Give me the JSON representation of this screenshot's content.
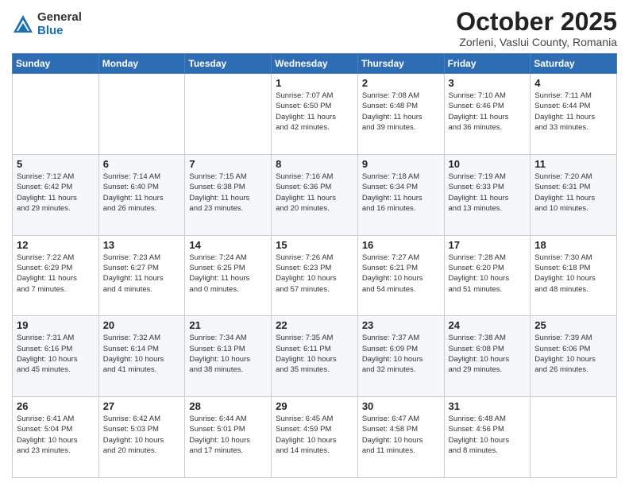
{
  "logo": {
    "general": "General",
    "blue": "Blue"
  },
  "header": {
    "month": "October 2025",
    "location": "Zorleni, Vaslui County, Romania"
  },
  "days_of_week": [
    "Sunday",
    "Monday",
    "Tuesday",
    "Wednesday",
    "Thursday",
    "Friday",
    "Saturday"
  ],
  "weeks": [
    [
      {
        "day": "",
        "info": ""
      },
      {
        "day": "",
        "info": ""
      },
      {
        "day": "",
        "info": ""
      },
      {
        "day": "1",
        "info": "Sunrise: 7:07 AM\nSunset: 6:50 PM\nDaylight: 11 hours\nand 42 minutes."
      },
      {
        "day": "2",
        "info": "Sunrise: 7:08 AM\nSunset: 6:48 PM\nDaylight: 11 hours\nand 39 minutes."
      },
      {
        "day": "3",
        "info": "Sunrise: 7:10 AM\nSunset: 6:46 PM\nDaylight: 11 hours\nand 36 minutes."
      },
      {
        "day": "4",
        "info": "Sunrise: 7:11 AM\nSunset: 6:44 PM\nDaylight: 11 hours\nand 33 minutes."
      }
    ],
    [
      {
        "day": "5",
        "info": "Sunrise: 7:12 AM\nSunset: 6:42 PM\nDaylight: 11 hours\nand 29 minutes."
      },
      {
        "day": "6",
        "info": "Sunrise: 7:14 AM\nSunset: 6:40 PM\nDaylight: 11 hours\nand 26 minutes."
      },
      {
        "day": "7",
        "info": "Sunrise: 7:15 AM\nSunset: 6:38 PM\nDaylight: 11 hours\nand 23 minutes."
      },
      {
        "day": "8",
        "info": "Sunrise: 7:16 AM\nSunset: 6:36 PM\nDaylight: 11 hours\nand 20 minutes."
      },
      {
        "day": "9",
        "info": "Sunrise: 7:18 AM\nSunset: 6:34 PM\nDaylight: 11 hours\nand 16 minutes."
      },
      {
        "day": "10",
        "info": "Sunrise: 7:19 AM\nSunset: 6:33 PM\nDaylight: 11 hours\nand 13 minutes."
      },
      {
        "day": "11",
        "info": "Sunrise: 7:20 AM\nSunset: 6:31 PM\nDaylight: 11 hours\nand 10 minutes."
      }
    ],
    [
      {
        "day": "12",
        "info": "Sunrise: 7:22 AM\nSunset: 6:29 PM\nDaylight: 11 hours\nand 7 minutes."
      },
      {
        "day": "13",
        "info": "Sunrise: 7:23 AM\nSunset: 6:27 PM\nDaylight: 11 hours\nand 4 minutes."
      },
      {
        "day": "14",
        "info": "Sunrise: 7:24 AM\nSunset: 6:25 PM\nDaylight: 11 hours\nand 0 minutes."
      },
      {
        "day": "15",
        "info": "Sunrise: 7:26 AM\nSunset: 6:23 PM\nDaylight: 10 hours\nand 57 minutes."
      },
      {
        "day": "16",
        "info": "Sunrise: 7:27 AM\nSunset: 6:21 PM\nDaylight: 10 hours\nand 54 minutes."
      },
      {
        "day": "17",
        "info": "Sunrise: 7:28 AM\nSunset: 6:20 PM\nDaylight: 10 hours\nand 51 minutes."
      },
      {
        "day": "18",
        "info": "Sunrise: 7:30 AM\nSunset: 6:18 PM\nDaylight: 10 hours\nand 48 minutes."
      }
    ],
    [
      {
        "day": "19",
        "info": "Sunrise: 7:31 AM\nSunset: 6:16 PM\nDaylight: 10 hours\nand 45 minutes."
      },
      {
        "day": "20",
        "info": "Sunrise: 7:32 AM\nSunset: 6:14 PM\nDaylight: 10 hours\nand 41 minutes."
      },
      {
        "day": "21",
        "info": "Sunrise: 7:34 AM\nSunset: 6:13 PM\nDaylight: 10 hours\nand 38 minutes."
      },
      {
        "day": "22",
        "info": "Sunrise: 7:35 AM\nSunset: 6:11 PM\nDaylight: 10 hours\nand 35 minutes."
      },
      {
        "day": "23",
        "info": "Sunrise: 7:37 AM\nSunset: 6:09 PM\nDaylight: 10 hours\nand 32 minutes."
      },
      {
        "day": "24",
        "info": "Sunrise: 7:38 AM\nSunset: 6:08 PM\nDaylight: 10 hours\nand 29 minutes."
      },
      {
        "day": "25",
        "info": "Sunrise: 7:39 AM\nSunset: 6:06 PM\nDaylight: 10 hours\nand 26 minutes."
      }
    ],
    [
      {
        "day": "26",
        "info": "Sunrise: 6:41 AM\nSunset: 5:04 PM\nDaylight: 10 hours\nand 23 minutes."
      },
      {
        "day": "27",
        "info": "Sunrise: 6:42 AM\nSunset: 5:03 PM\nDaylight: 10 hours\nand 20 minutes."
      },
      {
        "day": "28",
        "info": "Sunrise: 6:44 AM\nSunset: 5:01 PM\nDaylight: 10 hours\nand 17 minutes."
      },
      {
        "day": "29",
        "info": "Sunrise: 6:45 AM\nSunset: 4:59 PM\nDaylight: 10 hours\nand 14 minutes."
      },
      {
        "day": "30",
        "info": "Sunrise: 6:47 AM\nSunset: 4:58 PM\nDaylight: 10 hours\nand 11 minutes."
      },
      {
        "day": "31",
        "info": "Sunrise: 6:48 AM\nSunset: 4:56 PM\nDaylight: 10 hours\nand 8 minutes."
      },
      {
        "day": "",
        "info": ""
      }
    ]
  ]
}
